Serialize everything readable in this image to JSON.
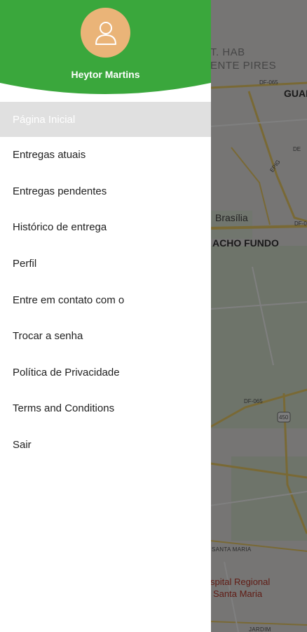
{
  "map": {
    "labels": {
      "hab": "T. HAB",
      "vicente_pires": "ENTE PIRES",
      "guara": "GUAR",
      "brasilia": "Brasília",
      "riacho_fundo": "ACHO FUNDO",
      "df065_top": "DF-065",
      "df065_mid": "DF-065",
      "de": "DE",
      "epig": "EPIG",
      "df_right": "DF-0",
      "route_450": "450",
      "santa_maria": "SANTA MARIA",
      "hospital_line1": "spital Regional",
      "hospital_line2": "Santa Maria",
      "jardim": "JARDIM"
    }
  },
  "drawer": {
    "user_name": "Heytor Martins",
    "avatar_icon": "user-icon",
    "header_color": "#3aa73c",
    "avatar_color": "#eab478",
    "menu": [
      {
        "label": "Página Inicial",
        "active": true
      },
      {
        "label": "Entregas atuais"
      },
      {
        "label": "Entregas pendentes"
      },
      {
        "label": "Histórico de entrega"
      },
      {
        "label": "Perfil"
      },
      {
        "label": "Entre em contato com o"
      },
      {
        "label": "Trocar a senha"
      },
      {
        "label": "Política de Privacidade"
      },
      {
        "label": "Terms and Conditions"
      },
      {
        "label": "Sair"
      }
    ]
  }
}
